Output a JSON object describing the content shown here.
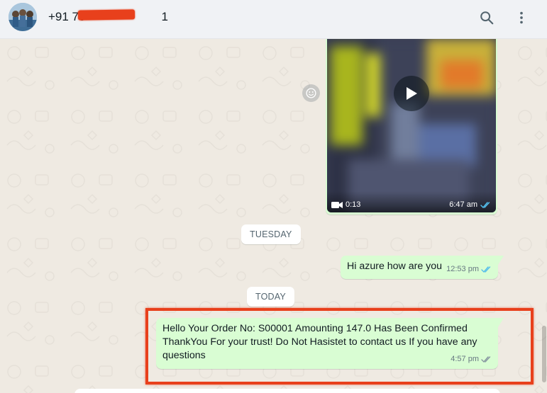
{
  "header": {
    "contact_name": "+91 70",
    "redacted_suffix": "1"
  },
  "video_message": {
    "duration": "0:13",
    "time": "6:47 am",
    "status": "read"
  },
  "date_chips": {
    "tuesday": "TUESDAY",
    "today": "TODAY"
  },
  "messages": [
    {
      "text": "Hi azure how are you",
      "time": "12:53 pm",
      "status": "read"
    },
    {
      "text": "Hello Your Order No: S00001 Amounting 147.0 Has Been Confirmed ThankYou For your trust! Do Not Hasistet to contact us If you have any questions",
      "time": "4:57 pm",
      "status": "delivered"
    }
  ],
  "colors": {
    "header_bg": "#f0f2f5",
    "chat_bg": "#efeae2",
    "outgoing_bubble": "#d9fdd3",
    "read_tick": "#53bdeb",
    "delivered_tick": "#8696a0",
    "annotation_red": "#e8401c"
  },
  "icons": {
    "search": "search-icon",
    "menu": "kebab-menu-icon",
    "play": "play-icon",
    "video": "video-camera-icon",
    "emoji": "emoji-icon",
    "ticks": "double-check-icon"
  }
}
